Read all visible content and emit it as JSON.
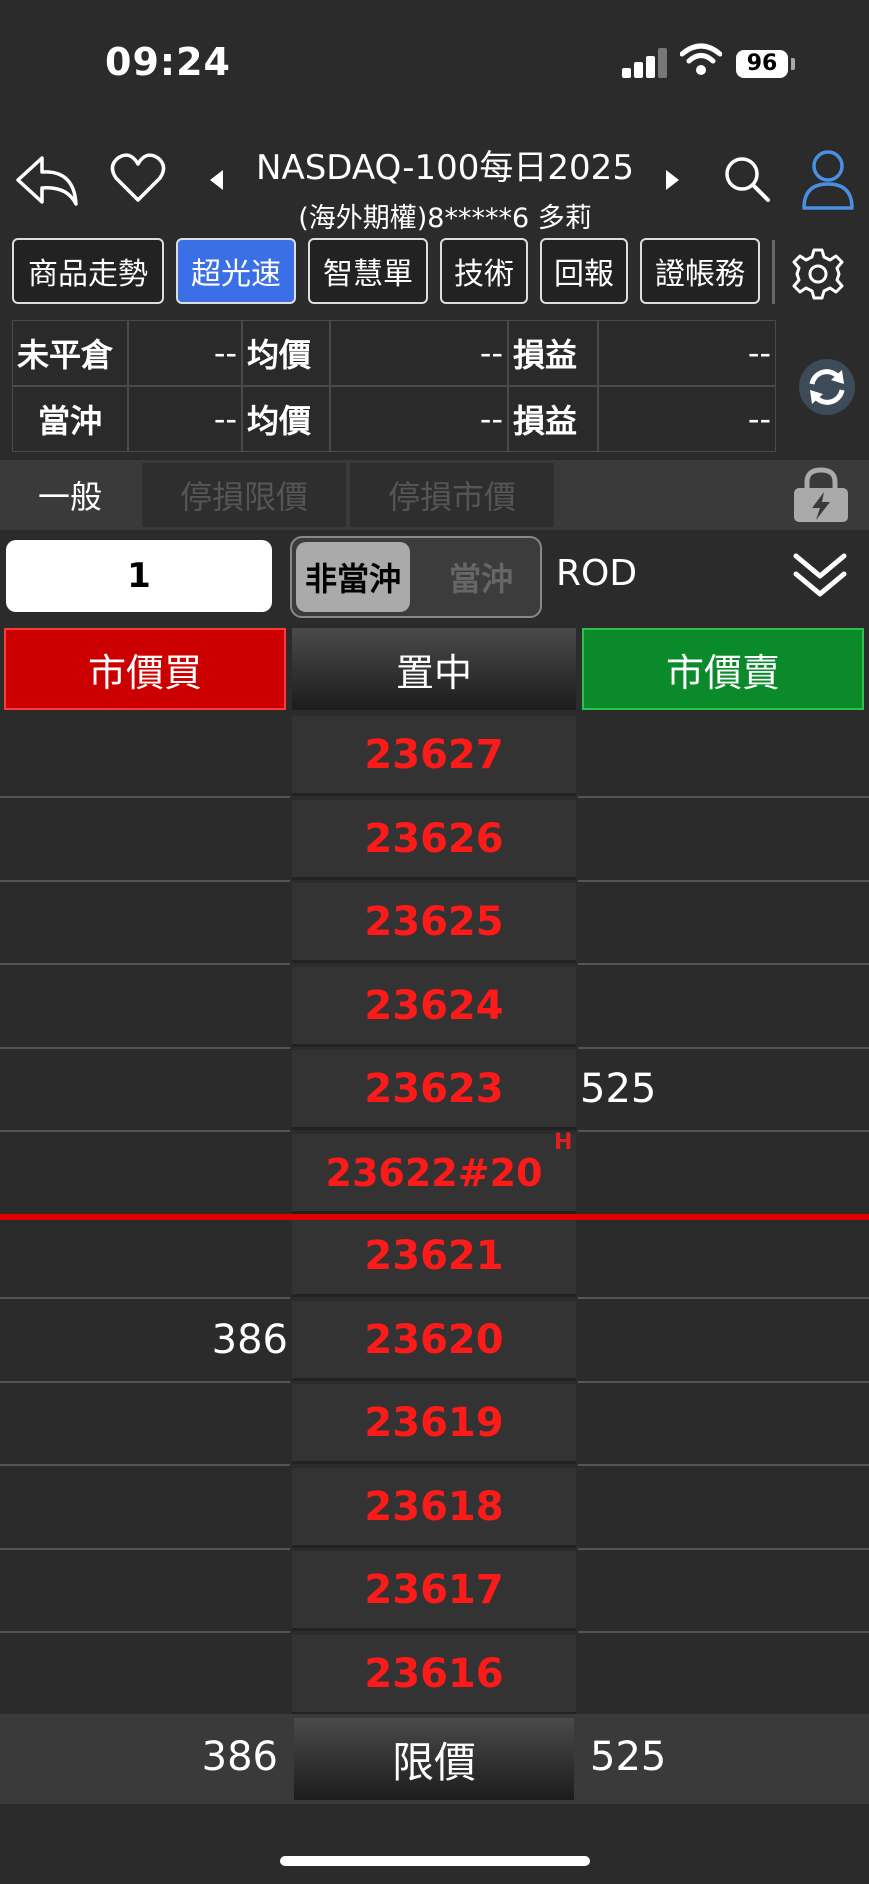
{
  "status": {
    "time": "09:24",
    "battery": "96"
  },
  "nav": {
    "title": "NASDAQ-100每日2025",
    "subtitle": "(海外期權)8*****6  多莉"
  },
  "tabs": [
    "商品走勢",
    "超光速",
    "智慧單",
    "技術",
    "回報",
    "證帳務"
  ],
  "active_tab": "超光速",
  "positions": {
    "row1": {
      "label": "未平倉",
      "value": "--",
      "avg_label": "均價",
      "avg_value": "--",
      "pl_label": "損益",
      "pl_value": "--"
    },
    "row2": {
      "label": "當沖",
      "value": "--",
      "avg_label": "均價",
      "avg_value": "--",
      "pl_label": "損益",
      "pl_value": "--"
    }
  },
  "order_types": [
    "一般",
    "停損限價",
    "停損市價"
  ],
  "order_form": {
    "quantity": "1",
    "mode_selected": "非當沖",
    "mode_other": "當沖",
    "tif": "ROD"
  },
  "actions": {
    "market_buy": "市價買",
    "center": "置中",
    "market_sell": "市價賣"
  },
  "ladder": {
    "prices": [
      "23627",
      "23626",
      "23625",
      "23624",
      "23623",
      "23622#20",
      "23621",
      "23620",
      "23619",
      "23618",
      "23617",
      "23616"
    ],
    "high_marker": "H",
    "ask_qty": {
      "row": 4,
      "value": "525"
    },
    "bid_qty": {
      "row": 7,
      "value": "386"
    }
  },
  "footer": {
    "bid_total": "386",
    "limit_label": "限價",
    "ask_total": "525"
  },
  "colors": {
    "buy": "#cc0000",
    "sell": "#0a8a2a",
    "price_text": "#ff1a1a",
    "accent": "#3b6fe6",
    "last_line": "#e00000"
  }
}
